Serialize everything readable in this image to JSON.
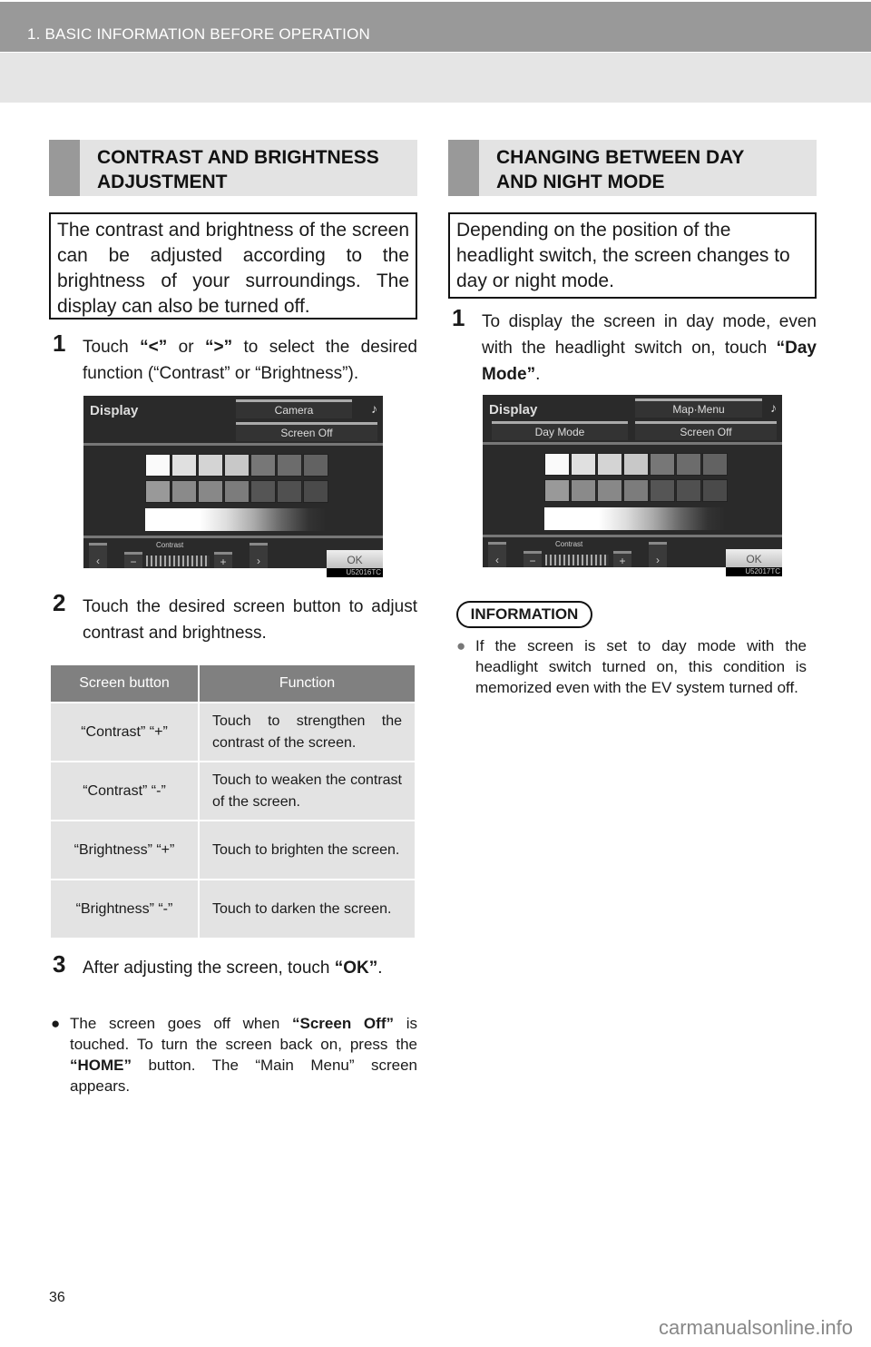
{
  "header": {
    "chapter": "1. BASIC INFORMATION BEFORE OPERATION"
  },
  "left": {
    "section_title_line1": "CONTRAST AND BRIGHTNESS",
    "section_title_line2": "ADJUSTMENT",
    "intro": "The contrast and brightness of the screen can be adjusted according to the brightness of your surroundings. The display can also be turned off.",
    "step1": {
      "num": "1",
      "pre": "Touch ",
      "b1": "“<”",
      "mid": " or ",
      "b2": "“>”",
      "post": " to select the desired function (“Contrast” or “Brightness”)."
    },
    "screen": {
      "title": "Display",
      "btn1": "Camera",
      "btn2": "Screen Off",
      "music": "♪",
      "left_arrow": "‹",
      "right_arrow": "›",
      "minus": "−",
      "plus": "+",
      "ctrl_label": "Contrast",
      "ok": "OK",
      "code": "U52016TC"
    },
    "step2": {
      "num": "2",
      "text": "Touch the desired screen button to adjust contrast and brightness."
    },
    "table": {
      "headers": [
        "Screen button",
        "Function"
      ],
      "rows": [
        [
          "“Contrast” “+”",
          "Touch to strengthen the contrast of the screen."
        ],
        [
          "“Contrast” “-”",
          "Touch to weaken the contrast of the screen."
        ],
        [
          "“Brightness” “+”",
          "Touch to brighten the screen."
        ],
        [
          "“Brightness” “-”",
          "Touch to darken the screen."
        ]
      ]
    },
    "step3": {
      "num": "3",
      "pre": "After adjusting the screen, touch ",
      "b": "“OK”",
      "post": "."
    },
    "bullet": {
      "dot": "●",
      "p1": "The screen goes off when ",
      "b1": "“Screen Off”",
      "p2": " is touched. To turn the screen back on, press the ",
      "b2": "“HOME”",
      "p3": " button. The “Main Menu” screen appears."
    }
  },
  "right": {
    "section_title_line1": "CHANGING BETWEEN DAY",
    "section_title_line2": "AND NIGHT MODE",
    "intro": "Depending on the position of the headlight switch, the screen changes to day or night mode.",
    "step1": {
      "num": "1",
      "pre": "To display the screen in day mode, even with the headlight switch on, touch ",
      "b": "“Day Mode”",
      "post": "."
    },
    "screen": {
      "title": "Display",
      "btn1": "Map·Menu",
      "btn_day": "Day Mode",
      "btn2": "Screen Off",
      "music": "♪",
      "left_arrow": "‹",
      "right_arrow": "›",
      "minus": "−",
      "plus": "+",
      "ctrl_label": "Contrast",
      "ok": "OK",
      "code": "U52017TC"
    },
    "info": {
      "tag": "INFORMATION",
      "dot": "●",
      "text": "If the screen is set to day mode with the headlight switch turned on, this condition is memorized even with the EV system turned off."
    }
  },
  "footer": {
    "page_number": "36",
    "watermark": "carmanualsonline.info"
  }
}
